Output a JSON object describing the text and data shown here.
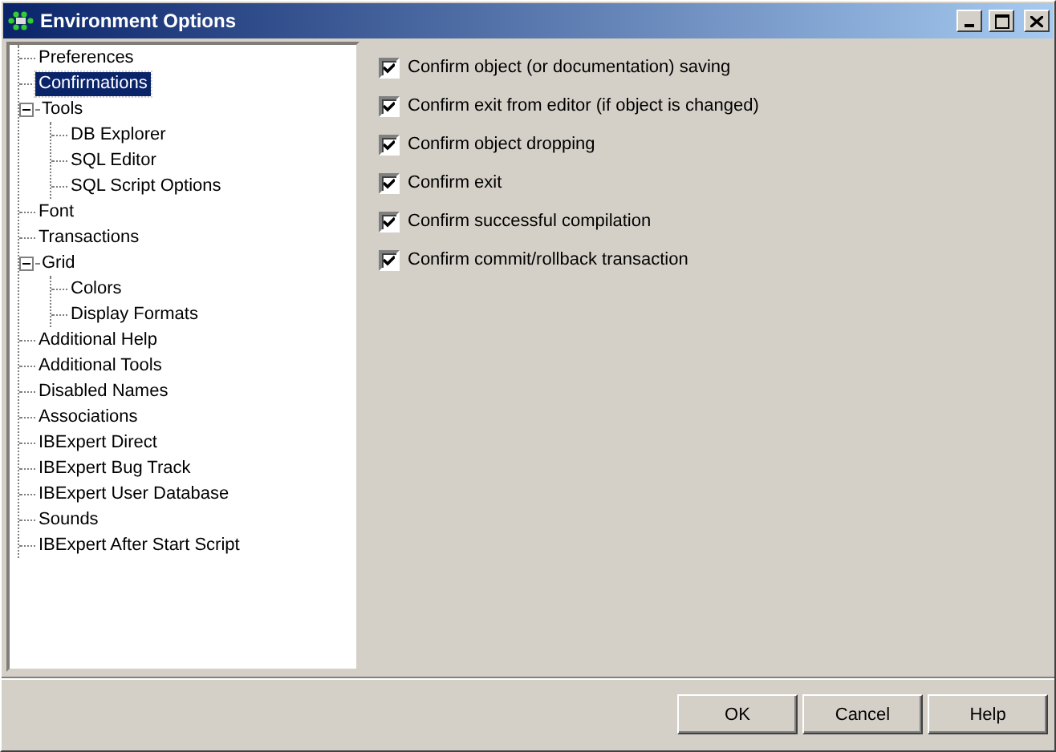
{
  "window": {
    "title": "Environment Options"
  },
  "tree": [
    {
      "label": "Preferences",
      "selected": false
    },
    {
      "label": "Confirmations",
      "selected": true
    },
    {
      "label": "Tools",
      "selected": false,
      "expanded": true,
      "children": [
        {
          "label": "DB Explorer",
          "selected": false
        },
        {
          "label": "SQL Editor",
          "selected": false
        },
        {
          "label": "SQL Script Options",
          "selected": false
        }
      ]
    },
    {
      "label": "Font",
      "selected": false
    },
    {
      "label": "Transactions",
      "selected": false
    },
    {
      "label": "Grid",
      "selected": false,
      "expanded": true,
      "children": [
        {
          "label": "Colors",
          "selected": false
        },
        {
          "label": "Display Formats",
          "selected": false
        }
      ]
    },
    {
      "label": "Additional Help",
      "selected": false
    },
    {
      "label": "Additional Tools",
      "selected": false
    },
    {
      "label": "Disabled Names",
      "selected": false
    },
    {
      "label": "Associations",
      "selected": false
    },
    {
      "label": "IBExpert Direct",
      "selected": false
    },
    {
      "label": "IBExpert Bug Track",
      "selected": false
    },
    {
      "label": "IBExpert User Database",
      "selected": false
    },
    {
      "label": "Sounds",
      "selected": false
    },
    {
      "label": "IBExpert After Start Script",
      "selected": false
    }
  ],
  "options": [
    {
      "label": "Confirm object (or documentation) saving",
      "checked": true
    },
    {
      "label": "Confirm exit from editor (if object is changed)",
      "checked": true
    },
    {
      "label": "Confirm object dropping",
      "checked": true
    },
    {
      "label": "Confirm exit",
      "checked": true
    },
    {
      "label": "Confirm successful compilation",
      "checked": true
    },
    {
      "label": "Confirm commit/rollback transaction",
      "checked": true
    }
  ],
  "buttons": [
    "OK",
    "Cancel",
    "Help"
  ]
}
